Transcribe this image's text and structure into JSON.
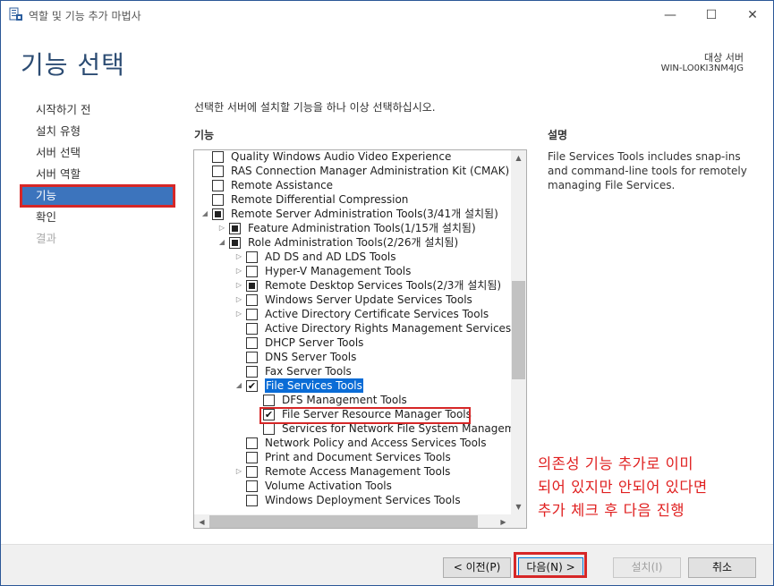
{
  "window": {
    "title": "역할 및 기능 추가 마법사",
    "minimize_glyph": "—",
    "maximize_glyph": "☐",
    "close_glyph": "✕"
  },
  "header": {
    "page_title": "기능 선택",
    "target_label": "대상 서버",
    "target_name": "WIN-LO0KI3NM4JG"
  },
  "nav": {
    "items": [
      {
        "label": "시작하기 전",
        "state": "normal"
      },
      {
        "label": "설치 유형",
        "state": "normal"
      },
      {
        "label": "서버 선택",
        "state": "normal"
      },
      {
        "label": "서버 역할",
        "state": "normal"
      },
      {
        "label": "기능",
        "state": "active"
      },
      {
        "label": "확인",
        "state": "normal"
      },
      {
        "label": "결과",
        "state": "disabled"
      }
    ]
  },
  "main": {
    "instruction": "선택한 서버에 설치할 기능을 하나 이상 선택하십시오.",
    "features_header": "기능",
    "description_header": "설명",
    "description_text": "File Services Tools includes snap-ins and command-line tools for remotely managing File Services."
  },
  "tree": {
    "items": [
      {
        "label": "Quality Windows Audio Video Experience",
        "level": 0,
        "check": "none",
        "expander": "none"
      },
      {
        "label": "RAS Connection Manager Administration Kit (CMAK)",
        "level": 0,
        "check": "none",
        "expander": "none"
      },
      {
        "label": "Remote Assistance",
        "level": 0,
        "check": "none",
        "expander": "none"
      },
      {
        "label": "Remote Differential Compression",
        "level": 0,
        "check": "none",
        "expander": "none"
      },
      {
        "label": "Remote Server Administration Tools(3/41개 설치됨)",
        "level": 0,
        "check": "partial",
        "expander": "expanded"
      },
      {
        "label": "Feature Administration Tools(1/15개 설치됨)",
        "level": 1,
        "check": "partial",
        "expander": "collapsed"
      },
      {
        "label": "Role Administration Tools(2/26개 설치됨)",
        "level": 1,
        "check": "partial",
        "expander": "expanded"
      },
      {
        "label": "AD DS and AD LDS Tools",
        "level": 2,
        "check": "none",
        "expander": "collapsed"
      },
      {
        "label": "Hyper-V Management Tools",
        "level": 2,
        "check": "none",
        "expander": "collapsed"
      },
      {
        "label": "Remote Desktop Services Tools(2/3개 설치됨)",
        "level": 2,
        "check": "partial",
        "expander": "collapsed"
      },
      {
        "label": "Windows Server Update Services Tools",
        "level": 2,
        "check": "none",
        "expander": "collapsed"
      },
      {
        "label": "Active Directory Certificate Services Tools",
        "level": 2,
        "check": "none",
        "expander": "collapsed"
      },
      {
        "label": "Active Directory Rights Management Services Tools",
        "level": 2,
        "check": "none",
        "expander": "none"
      },
      {
        "label": "DHCP Server Tools",
        "level": 2,
        "check": "none",
        "expander": "none"
      },
      {
        "label": "DNS Server Tools",
        "level": 2,
        "check": "none",
        "expander": "none"
      },
      {
        "label": "Fax Server Tools",
        "level": 2,
        "check": "none",
        "expander": "none"
      },
      {
        "label": "File Services Tools",
        "level": 2,
        "check": "checked",
        "expander": "expanded",
        "selected": true
      },
      {
        "label": "DFS Management Tools",
        "level": 3,
        "check": "none",
        "expander": "none"
      },
      {
        "label": "File Server Resource Manager Tools",
        "level": 3,
        "check": "checked",
        "expander": "none"
      },
      {
        "label": "Services for Network File System Management Tools",
        "level": 3,
        "check": "none",
        "expander": "none"
      },
      {
        "label": "Network Policy and Access Services Tools",
        "level": 2,
        "check": "none",
        "expander": "none"
      },
      {
        "label": "Print and Document Services Tools",
        "level": 2,
        "check": "none",
        "expander": "none"
      },
      {
        "label": "Remote Access Management Tools",
        "level": 2,
        "check": "none",
        "expander": "collapsed"
      },
      {
        "label": "Volume Activation Tools",
        "level": 2,
        "check": "none",
        "expander": "none"
      },
      {
        "label": "Windows Deployment Services Tools",
        "level": 2,
        "check": "none",
        "expander": "none"
      }
    ]
  },
  "annotation": {
    "lines": [
      "의존성 기능 추가로 이미",
      "되어 있지만 안되어 있다면",
      "추가 체크 후 다음 진행"
    ]
  },
  "footer": {
    "prev_label": "< 이전(P)",
    "next_label": "다음(N) >",
    "install_label": "설치(I)",
    "cancel_label": "취소"
  },
  "colors": {
    "accent": "#0a6cd6",
    "title_blue": "#2c4c73",
    "annotation_red": "#e02020"
  }
}
